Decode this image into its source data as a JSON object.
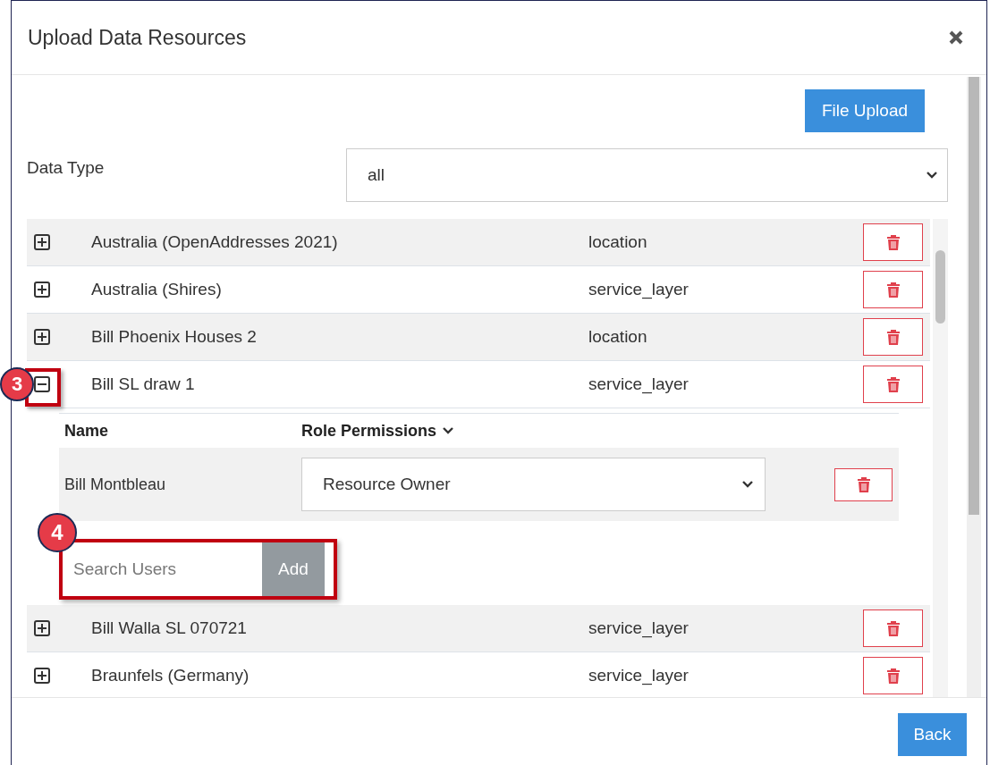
{
  "dialog": {
    "title": "Upload Data Resources"
  },
  "file_upload_button": "File Upload",
  "data_type": {
    "label": "Data Type",
    "value": "all"
  },
  "resources": [
    {
      "name": "Australia (OpenAddresses 2021)",
      "type": "location",
      "expanded": false
    },
    {
      "name": "Australia (Shires)",
      "type": "service_layer",
      "expanded": false
    },
    {
      "name": "Bill Phoenix Houses 2",
      "type": "location",
      "expanded": false
    },
    {
      "name": "Bill SL draw 1",
      "type": "service_layer",
      "expanded": true,
      "callout": "3",
      "permissions": {
        "columns": [
          "Name",
          "Role Permissions"
        ],
        "rows": [
          {
            "name": "Bill Montbleau",
            "role": "Resource Owner"
          }
        ],
        "search": {
          "placeholder": "Search Users",
          "button": "Add",
          "callout": "4"
        }
      }
    },
    {
      "name": "Bill Walla SL 070721",
      "type": "service_layer",
      "expanded": false
    },
    {
      "name": "Braunfels (Germany)",
      "type": "service_layer",
      "expanded": false
    }
  ],
  "footer": {
    "back_button": "Back"
  }
}
